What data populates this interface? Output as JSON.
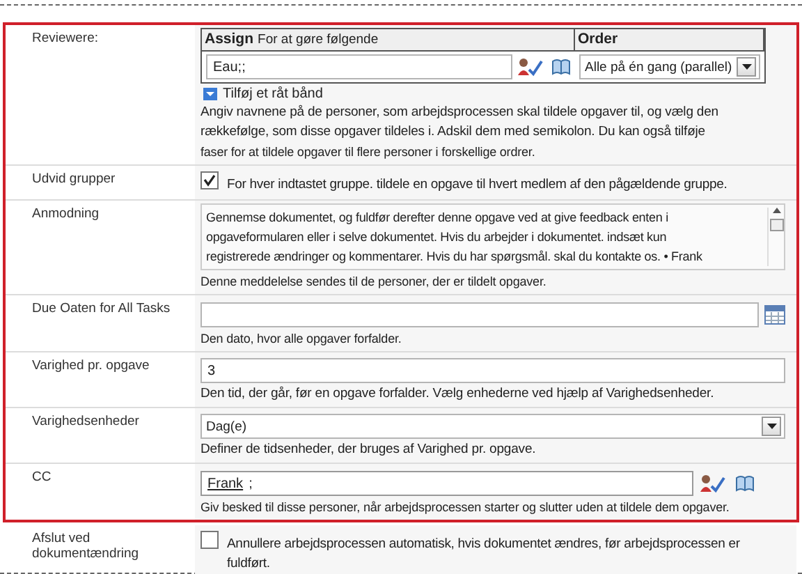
{
  "sections": [
    {
      "highlighted": true,
      "rows": [
        {
          "kind": "assign",
          "label": "Reviewere:",
          "assign_header": "Assign",
          "assign_subheader": "For at gøre følgende",
          "order_header": "Order",
          "assign_value": "Eau;;",
          "order_value": "Alle på én gang (parallel)",
          "add_stage": "Tilføj et råt bånd",
          "hint_lines": [
            "Angiv navnene på de personer, som arbejdsprocessen skal tildele opgaver til, og vælg den",
            "rækkefølge, som disse opgaver tildeles i. Adskil dem med semikolon. Du kan også tilføje",
            "faser for at tildele opgaver til flere personer i forskellige ordrer."
          ]
        },
        {
          "kind": "checkbox",
          "label": "Udvid grupper",
          "checked": true,
          "text": "For hver indtastet gruppe. tildele en opgave til hvert medlem af den pågældende gruppe."
        },
        {
          "kind": "textarea",
          "label": "Anmodning",
          "value_lines": [
            "Gennemse dokumentet, og fuldfør derefter denne opgave ved at give feedback enten i",
            "opgaveformularen eller i selve dokumentet. Hvis du arbejder i dokumentet. indsæt kun",
            "registrerede ændringer og kommentarer. Hvis du har spørgsmål. skal du kontakte os. • Frank"
          ],
          "hint": "Denne meddelelse sendes til de personer, der er tildelt opgaver."
        },
        {
          "kind": "date",
          "label": "Due Oaten for All Tasks",
          "hint": "Den dato, hvor alle opgaver forfalder."
        },
        {
          "kind": "text",
          "label": "Varighed pr. opgave",
          "value": "3",
          "hint": "Den tid, der går, før en opgave forfalder. Vælg enhederne ved hjælp af Varighedsenheder."
        },
        {
          "kind": "select",
          "label": "Varighedsenheder",
          "value": "Dag(e)",
          "hint": "Definer de tidsenheder, der bruges af Varighed pr. opgave."
        },
        {
          "kind": "people",
          "label": "CC",
          "value": "Frank",
          "value_suffix": ";",
          "hint": "Giv besked til disse personer, når arbejdsprocessen starter og slutter uden at tildele dem opgaver."
        }
      ]
    },
    {
      "highlighted": false,
      "rows": [
        {
          "kind": "checkbox",
          "label": "Afslut ved dokumentændring",
          "checked": false,
          "text": "Annullere arbejdsprocessen automatisk, hvis dokumentet ændres, før arbejdsprocessen er fuldført."
        }
      ]
    }
  ]
}
